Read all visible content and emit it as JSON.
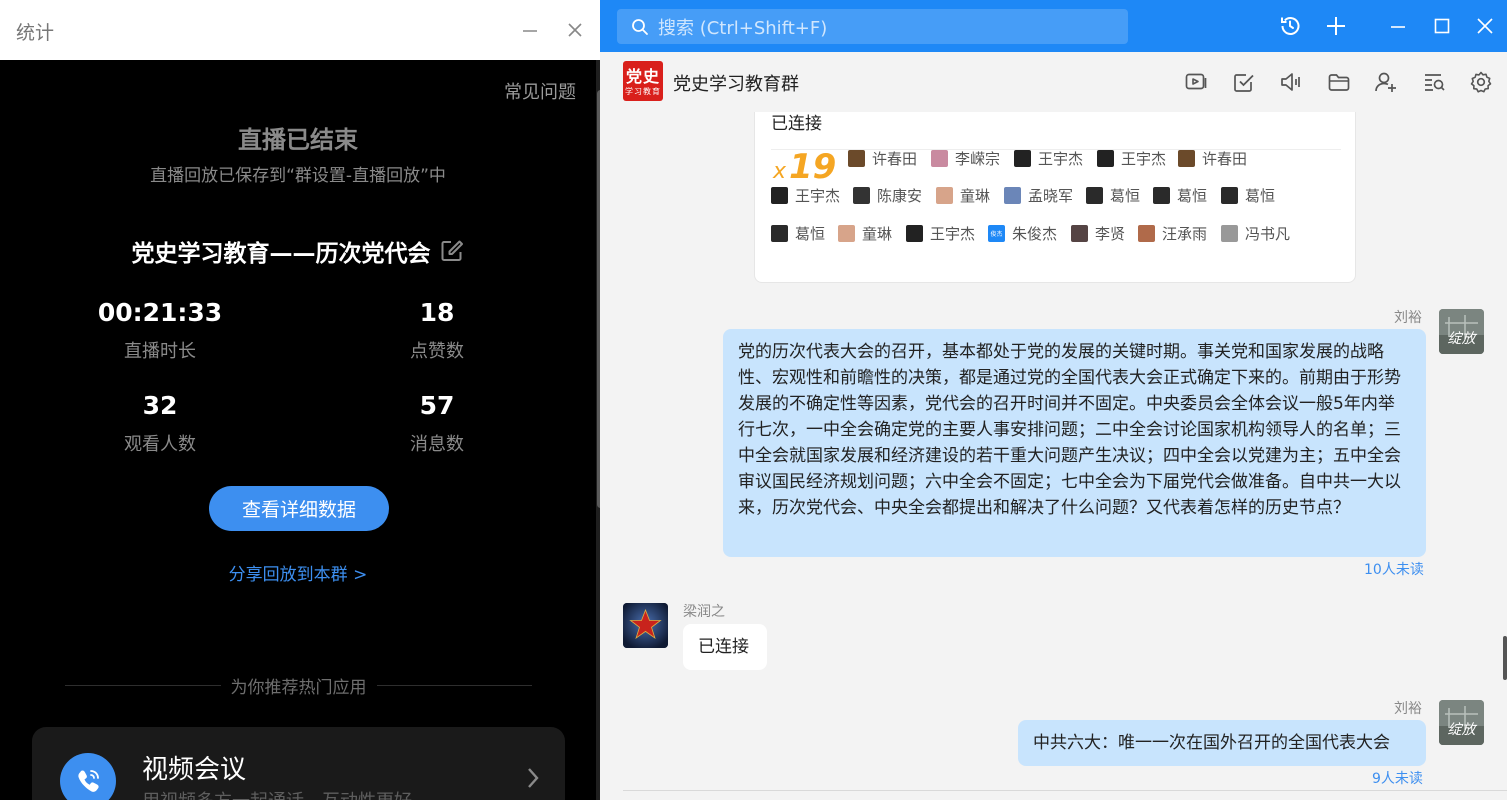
{
  "left_panel": {
    "title": "统计",
    "faq": "常见问题",
    "live_ended": "直播已结束",
    "replay_saved": "直播回放已保存到“群设置-直播回放”中",
    "live_title": "党史学习教育——历次党代会",
    "stats": [
      {
        "value": "00:21:33",
        "label": "直播时长"
      },
      {
        "value": "18",
        "label": "点赞数"
      },
      {
        "value": "32",
        "label": "观看人数"
      },
      {
        "value": "57",
        "label": "消息数"
      }
    ],
    "detail_button": "查看详细数据",
    "share_link": "分享回放到本群 >",
    "recommend": "为你推荐热门应用",
    "app": {
      "name": "视频会议",
      "desc": "用视频多方一起通话，互动性更好"
    }
  },
  "topbar": {
    "search_placeholder": "搜索 (Ctrl+Shift+F)"
  },
  "chat": {
    "group_name": "党史学习教育群",
    "group_avatar_big": "党史",
    "group_avatar_small": "学习教育",
    "conn_card": {
      "title": "已连接",
      "x": "x",
      "count": "19",
      "members": [
        {
          "name": "许春田",
          "color": "#6b4a2a"
        },
        {
          "name": "李嵘宗",
          "color": "#c98aa0"
        },
        {
          "name": "王宇杰",
          "color": "#222222"
        },
        {
          "name": "王宇杰",
          "color": "#222222"
        },
        {
          "name": "许春田",
          "color": "#6b4a2a"
        },
        {
          "name": "王宇杰",
          "color": "#222222"
        },
        {
          "name": "陈康安",
          "color": "#333333"
        },
        {
          "name": "童琳",
          "color": "#d7a48a"
        },
        {
          "name": "孟晓军",
          "color": "#6b86b8"
        },
        {
          "name": "葛恒",
          "color": "#2a2a2a"
        },
        {
          "name": "葛恒",
          "color": "#2a2a2a"
        },
        {
          "name": "葛恒",
          "color": "#2a2a2a"
        },
        {
          "name": "葛恒",
          "color": "#2a2a2a"
        },
        {
          "name": "童琳",
          "color": "#d7a48a"
        },
        {
          "name": "王宇杰",
          "color": "#222222"
        },
        {
          "name": "朱俊杰",
          "color": "#1e88f6"
        },
        {
          "name": "李贤",
          "color": "#554444"
        },
        {
          "name": "汪承雨",
          "color": "#b06a4a"
        },
        {
          "name": "冯书凡",
          "color": "#999999"
        }
      ],
      "member_icon_text": "俊杰"
    },
    "messages": [
      {
        "sender": "刘裕",
        "text": "党的历次代表大会的召开，基本都处于党的发展的关键时期。事关党和国家发展的战略性、宏观性和前瞻性的决策，都是通过党的全国代表大会正式确定下来的。前期由于形势发展的不确定性等因素，党代会的召开时间并不固定。中央委员会全体会议一般5年内举行七次，一中全会确定党的主要人事安排问题；二中全会讨论国家机构领导人的名单；三中全会就国家发展和经济建设的若干重大问题产生决议；四中全会以党建为主；五中全会审议国民经济规划问题；六中全会不固定；七中全会为下届党代会做准备。自中共一大以来，历次党代会、中央全会都提出和解决了什么问题？又代表着怎样的历史节点？",
        "unread": "10人未读"
      },
      {
        "sender": "梁润之",
        "text": "已连接"
      },
      {
        "sender": "刘裕",
        "text": "中共六大：唯一一次在国外召开的全国代表大会",
        "unread": "9人未读"
      }
    ],
    "avatar_text": "绽放"
  }
}
